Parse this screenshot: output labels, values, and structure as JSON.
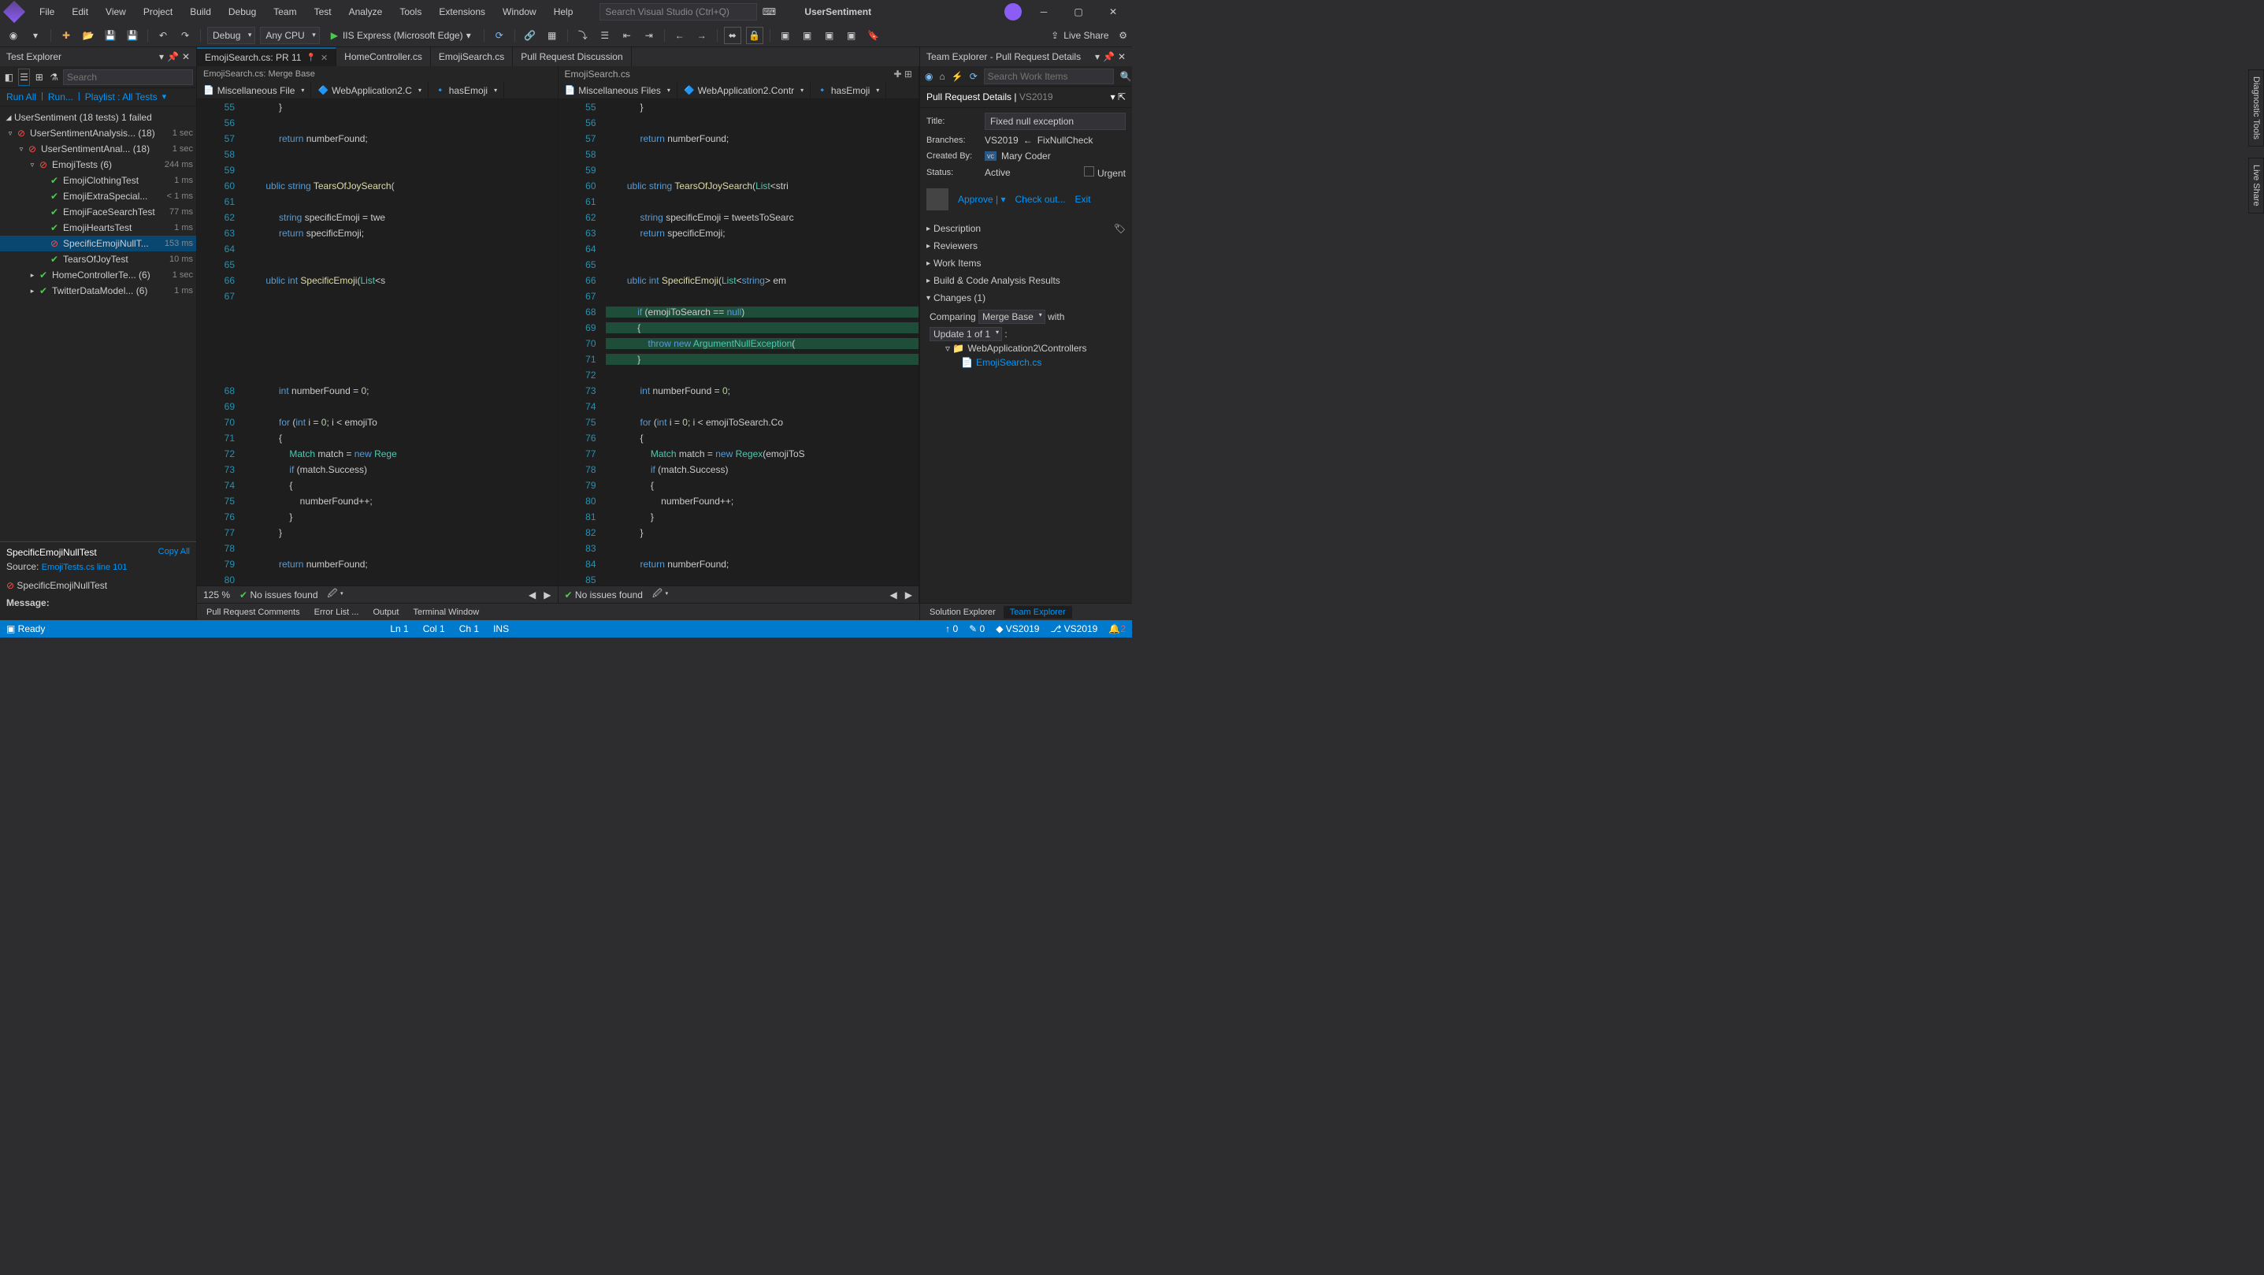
{
  "menu": [
    "File",
    "Edit",
    "View",
    "Project",
    "Build",
    "Debug",
    "Team",
    "Test",
    "Analyze",
    "Tools",
    "Extensions",
    "Window",
    "Help"
  ],
  "titlebar": {
    "search_placeholder": "Search Visual Studio (Ctrl+Q)",
    "solution": "UserSentiment"
  },
  "toolbar": {
    "config": "Debug",
    "platform": "Any CPU",
    "run": "IIS Express (Microsoft Edge)",
    "live_share": "Live Share"
  },
  "test_explorer": {
    "title": "Test Explorer",
    "search_placeholder": "Search",
    "links": [
      "Run All",
      "Run...",
      "Playlist : All Tests"
    ],
    "root": "UserSentiment (18 tests) 1 failed",
    "detail": {
      "name": "SpecificEmojiNullTest",
      "copy": "Copy All",
      "source_label": "Source:",
      "source_link": "EmojiTests.cs line 101",
      "fail_name": "SpecificEmojiNullTest",
      "message_label": "Message:"
    },
    "nodes": [
      {
        "d": 0,
        "a": "▿",
        "i": "fail",
        "t": "UserSentimentAnalysis... (18)",
        "time": "1 sec"
      },
      {
        "d": 1,
        "a": "▿",
        "i": "fail",
        "t": "UserSentimentAnal... (18)",
        "time": "1 sec"
      },
      {
        "d": 2,
        "a": "▿",
        "i": "fail",
        "t": "EmojiTests (6)",
        "time": "244 ms"
      },
      {
        "d": 3,
        "a": "",
        "i": "pass",
        "t": "EmojiClothingTest",
        "time": "1 ms"
      },
      {
        "d": 3,
        "a": "",
        "i": "pass",
        "t": "EmojiExtraSpecial...",
        "time": "< 1 ms"
      },
      {
        "d": 3,
        "a": "",
        "i": "pass",
        "t": "EmojiFaceSearchTest",
        "time": "77 ms"
      },
      {
        "d": 3,
        "a": "",
        "i": "pass",
        "t": "EmojiHeartsTest",
        "time": "1 ms"
      },
      {
        "d": 3,
        "a": "",
        "i": "fail",
        "t": "SpecificEmojiNullT...",
        "time": "153 ms",
        "sel": true
      },
      {
        "d": 3,
        "a": "",
        "i": "pass",
        "t": "TearsOfJoyTest",
        "time": "10 ms"
      },
      {
        "d": 2,
        "a": "▸",
        "i": "pass",
        "t": "HomeControllerTe... (6)",
        "time": "1 sec"
      },
      {
        "d": 2,
        "a": "▸",
        "i": "pass",
        "t": "TwitterDataModel... (6)",
        "time": "1 ms"
      }
    ]
  },
  "tabs": [
    {
      "label": "EmojiSearch.cs: PR 11",
      "active": true,
      "pin": true
    },
    {
      "label": "HomeController.cs"
    },
    {
      "label": "EmojiSearch.cs"
    },
    {
      "label": "Pull Request Discussion"
    }
  ],
  "left_pane": {
    "header": "EmojiSearch.cs: Merge Base",
    "nav": [
      "Miscellaneous File",
      "WebApplication2.C",
      "hasEmoji"
    ],
    "status_zoom": "125 %",
    "status_issues": "No issues found"
  },
  "right_pane": {
    "header": "EmojiSearch.cs",
    "nav": [
      "Miscellaneous Files",
      "WebApplication2.Contr",
      "hasEmoji"
    ],
    "status_issues": "No issues found"
  },
  "team_explorer": {
    "title": "Team Explorer - Pull Request Details",
    "search_placeholder": "Search Work Items",
    "header": "Pull Request Details",
    "header_sub": "VS2019",
    "title_label": "Title:",
    "title_value": "Fixed null exception",
    "branches_label": "Branches:",
    "branch_target": "VS2019",
    "branch_source": "FixNullCheck",
    "created_label": "Created By:",
    "created_badge": "vc",
    "created_value": "Mary Coder",
    "status_label": "Status:",
    "status_value": "Active",
    "urgent": "Urgent",
    "approve": "Approve",
    "checkout": "Check out...",
    "exit": "Exit",
    "sections": [
      "Description",
      "Reviewers",
      "Work Items",
      "Build & Code Analysis Results"
    ],
    "changes": "Changes (1)",
    "comparing": "Comparing",
    "compare_val": "Merge Base",
    "with": "with",
    "update": "Update 1 of 1",
    "folder": "WebApplication2\\Controllers",
    "file": "EmojiSearch.cs"
  },
  "bottom_tabs_left": [
    "Pull Request Comments",
    "Error List ...",
    "Output",
    "Terminal Window"
  ],
  "bottom_tabs_right": [
    "Solution Explorer",
    "Team Explorer"
  ],
  "statusbar": {
    "ready": "Ready",
    "ln": "Ln 1",
    "col": "Col 1",
    "ch": "Ch 1",
    "ins": "INS",
    "up": "0",
    "down": "0",
    "branch1": "VS2019",
    "branch2": "VS2019",
    "notif": "2"
  },
  "side_tab1": "Diagnostic Tools",
  "side_tab2": "Live Share"
}
